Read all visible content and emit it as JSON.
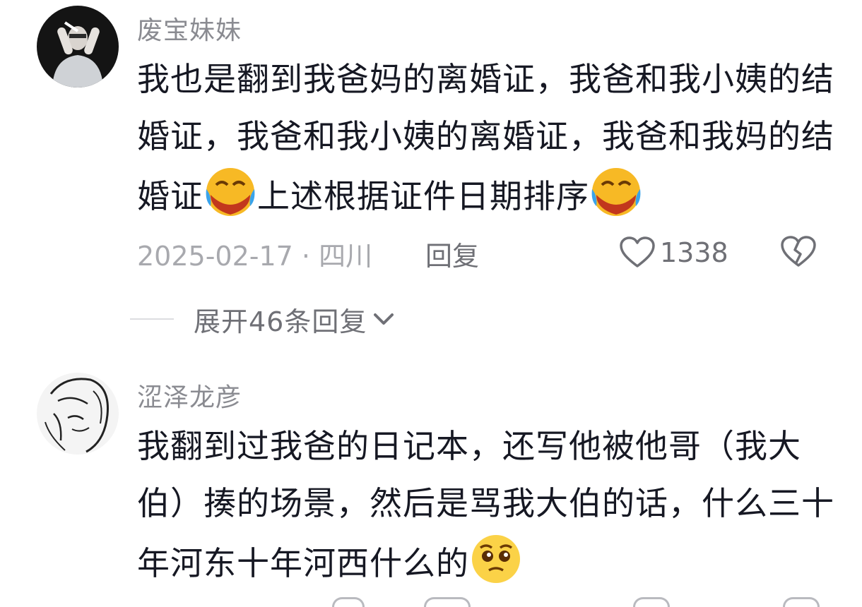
{
  "comments": [
    {
      "username": "废宝妹妹",
      "text_parts": [
        "我也是翻到我爸妈的离婚证，我爸和我小姨的结婚证，我爸和我小姨的离婚证，我爸和我妈的结婚证",
        "上述根据证件日期排序"
      ],
      "emoji": "laughing-crying-emoji",
      "date_location": "2025-02-17 · 四川",
      "reply_label": "回复",
      "likes": "1338",
      "expand_label": "展开46条回复"
    },
    {
      "username": "涩泽龙彦",
      "text": "我翻到过我爸的日记本，还写他被他哥（我大伯）揍的场景，然后是骂我大伯的话，什么三十年河东十年河西什么的",
      "emoji": "pleading-face-emoji"
    }
  ],
  "colors": {
    "text": "#161823",
    "meta": "#a8a9ae",
    "secondary": "#6f7076",
    "username": "#8a8b91"
  }
}
